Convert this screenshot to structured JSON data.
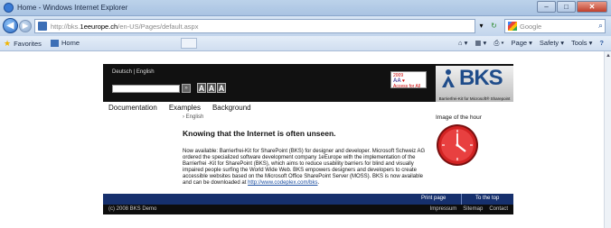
{
  "window": {
    "title": "Home - Windows Internet Explorer",
    "min_glyph": "–",
    "max_glyph": "□",
    "close_glyph": "✕"
  },
  "navbar": {
    "url_prefix": "http://bks.",
    "url_domain": "1eeurope.ch",
    "url_suffix": "/en-US/Pages/default.aspx",
    "search_placeholder": "Google",
    "back_glyph": "◀",
    "forward_glyph": "▶",
    "refresh_glyph": "↻",
    "stop_glyph": "✕",
    "dropdown_glyph": "▾",
    "search_glyph": "⌕"
  },
  "favbar": {
    "favorites_label": "Favorites",
    "tab_label": "Home",
    "commands": [
      "Page ▾",
      "Safety ▾",
      "Tools ▾"
    ],
    "help_glyph": "?"
  },
  "site": {
    "languages": "Deutsch | English",
    "go_glyph": "»",
    "font_sizes": [
      "A",
      "A",
      "A"
    ],
    "award_title": "AA",
    "award_subtitle": "Access for All",
    "award_year": "2009",
    "logo_word": "BKS",
    "logo_tagline": "Barrierfrei-Kit for Microsoft® Sharepoint",
    "nav": [
      "Documentation",
      "Examples",
      "Background"
    ],
    "breadcrumb": "› English",
    "image_title": "Image of the hour",
    "headline": "Knowing that the Internet is often unseen.",
    "body_text": "Now available: Barrierfrei-Kit for SharePoint (BKS) for designer and developer. Microsoft Schweiz AG ordered the specialized software development company 1eEurope with the implementation of the Barrierfrei -Kit for SharePoint (BKS), which aims to reduce usability barriers for blind and visually impaired people surfing the World Wide Web. BKS empowers designers and developers to create accessible websites based on the Microsoft Office SharePoint Server (MOSS). BKS is now available and can be downloaded at",
    "body_link": "http://www.codeplex.com/bks",
    "footer_links": {
      "print": "Print page",
      "top": "To the top"
    },
    "copyright": "(c) 2008 BKS Demo",
    "bottom_links": [
      "Impressum",
      "Sitemap",
      "Contact"
    ]
  },
  "colors": {
    "header_bg": "#111111",
    "footer_blue": "#16306d",
    "logo_blue": "#1f4c8a",
    "clock_red": "#d22323"
  }
}
